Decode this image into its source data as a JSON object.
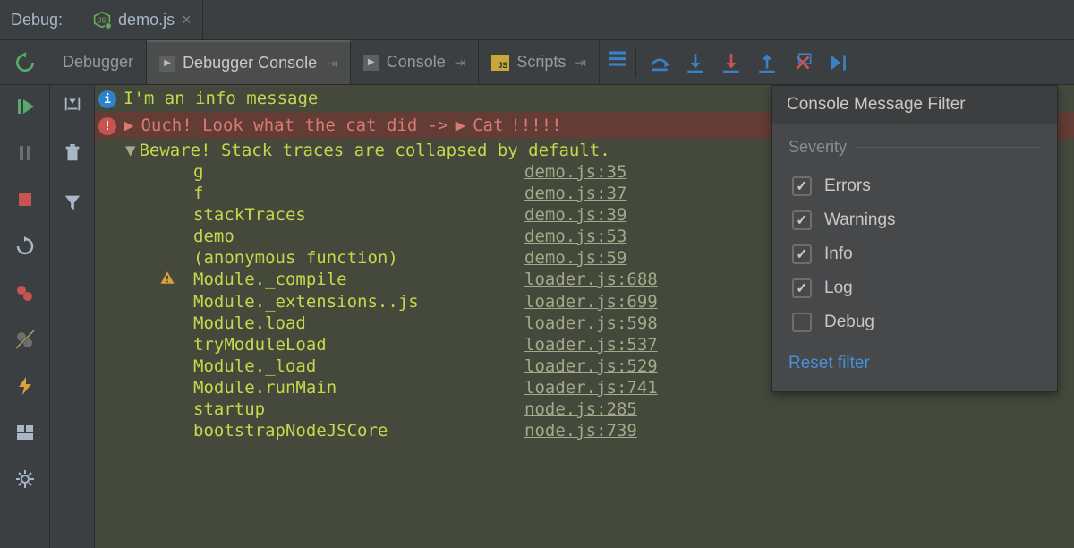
{
  "titlebar": {
    "label": "Debug:",
    "filename": "demo.js"
  },
  "tool_tabs": {
    "debugger": "Debugger",
    "debugger_console": "Debugger Console",
    "console": "Console",
    "scripts": "Scripts"
  },
  "console": {
    "info_msg": "I'm an info message",
    "error_msg_prefix": "Ouch! Look what the cat did ->",
    "error_msg_obj": "Cat",
    "error_msg_suffix": "!!!!!",
    "stack_header": "Beware! Stack traces are collapsed by default.",
    "stack": [
      {
        "fn": "g",
        "link": "demo.js:35"
      },
      {
        "fn": "f",
        "link": "demo.js:37"
      },
      {
        "fn": "stackTraces",
        "link": "demo.js:39"
      },
      {
        "fn": "demo",
        "link": "demo.js:53"
      },
      {
        "fn": "(anonymous function)",
        "link": "demo.js:59"
      },
      {
        "fn": "Module._compile",
        "link": "loader.js:688",
        "warn": true
      },
      {
        "fn": "Module._extensions..js",
        "link": "loader.js:699"
      },
      {
        "fn": "Module.load",
        "link": "loader.js:598"
      },
      {
        "fn": "tryModuleLoad",
        "link": "loader.js:537"
      },
      {
        "fn": "Module._load",
        "link": "loader.js:529"
      },
      {
        "fn": "Module.runMain",
        "link": "loader.js:741"
      },
      {
        "fn": "startup",
        "link": "node.js:285"
      },
      {
        "fn": "bootstrapNodeJSCore",
        "link": "node.js:739"
      }
    ]
  },
  "filter": {
    "title": "Console Message Filter",
    "section": "Severity",
    "errors": "Errors",
    "warnings": "Warnings",
    "info": "Info",
    "log": "Log",
    "debug": "Debug",
    "reset": "Reset filter",
    "state": {
      "errors": true,
      "warnings": true,
      "info": true,
      "log": true,
      "debug": false
    }
  },
  "colors": {
    "accent_green": "#c2d94c",
    "error_red": "#d97a74",
    "link_blue": "#4a90d9"
  }
}
